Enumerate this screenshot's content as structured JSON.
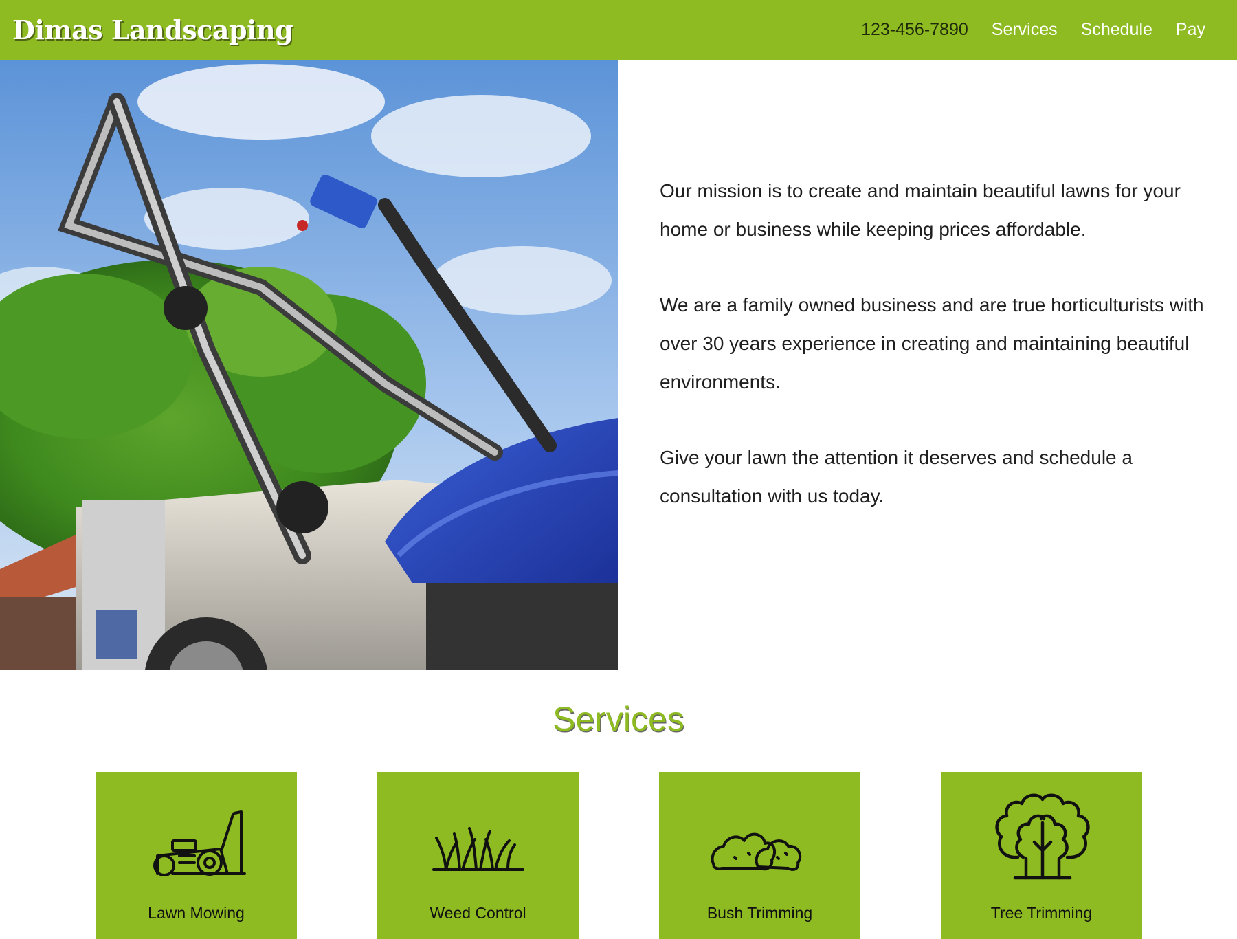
{
  "header": {
    "brand": "Dimas Landscaping",
    "nav": [
      {
        "label": "123-456-7890",
        "kind": "phone"
      },
      {
        "label": "Services",
        "kind": "link"
      },
      {
        "label": "Schedule",
        "kind": "link"
      },
      {
        "label": "Pay",
        "kind": "link"
      }
    ]
  },
  "hero": {
    "image_subject": "lawn mower photo",
    "paragraphs": [
      "Our mission is to create and maintain beautiful lawns for your home or business while keeping prices affordable.",
      "We are a family owned business and are true horticulturists with over 30 years experience in creating and maintaining beautiful environments.",
      "Give your lawn the attention it deserves and schedule a consultation with us today."
    ]
  },
  "services": {
    "title": "Services",
    "items": [
      {
        "label": "Lawn Mowing",
        "icon": "lawn-mower-icon"
      },
      {
        "label": "Weed Control",
        "icon": "grass-icon"
      },
      {
        "label": "Bush Trimming",
        "icon": "bush-icon"
      },
      {
        "label": "Tree Trimming",
        "icon": "trees-icon"
      }
    ]
  },
  "colors": {
    "brand_green": "#8fbb22",
    "text_dark": "#1f1f1f",
    "white": "#ffffff"
  }
}
